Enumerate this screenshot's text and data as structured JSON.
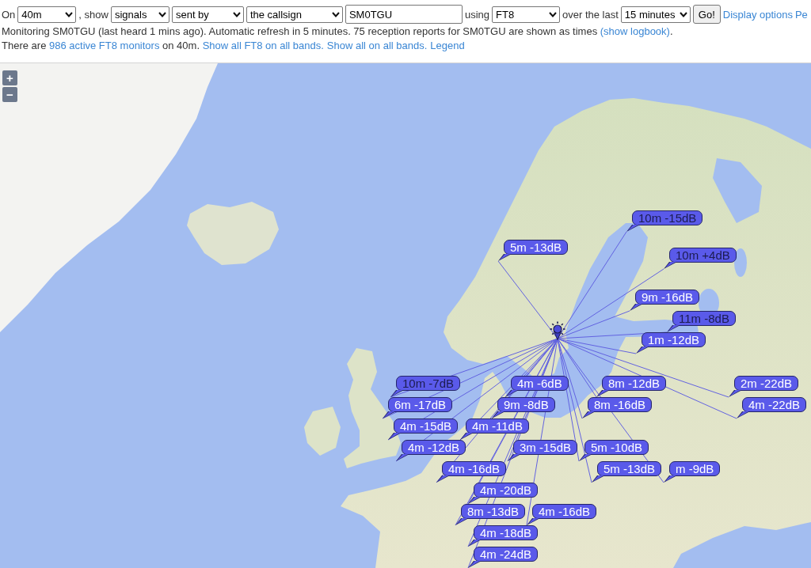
{
  "form": [
    {
      "kind": "text",
      "text": "On"
    },
    {
      "kind": "select",
      "value": "40m"
    },
    {
      "kind": "text",
      "text": ", show"
    },
    {
      "kind": "select",
      "value": "signals"
    },
    {
      "kind": "select",
      "value": "sent by"
    },
    {
      "kind": "select",
      "value": "the callsign"
    },
    {
      "kind": "input",
      "value": "SM0TGU"
    },
    {
      "kind": "text",
      "text": "using"
    },
    {
      "kind": "select",
      "value": "FT8"
    },
    {
      "kind": "text",
      "text": "over the last"
    },
    {
      "kind": "select",
      "value": "15 minutes"
    },
    {
      "kind": "button",
      "text": "Go!"
    },
    {
      "kind": "link",
      "text": "Display options"
    },
    {
      "kind": "link",
      "text": "Pe"
    }
  ],
  "status_lines": [
    [
      {
        "kind": "text",
        "text": "Monitoring SM0TGU (last heard 1 mins ago). Automatic refresh in 5 minutes. 75 reception reports for SM0TGU are shown as times "
      },
      {
        "kind": "link",
        "text": "(show logbook)"
      },
      {
        "kind": "text",
        "text": "."
      }
    ],
    [
      {
        "kind": "text",
        "text": "There are "
      },
      {
        "kind": "link",
        "text": "986 active FT8 monitors"
      },
      {
        "kind": "text",
        "text": " on 40m. "
      },
      {
        "kind": "link",
        "text": "Show all FT8 on all bands."
      },
      {
        "kind": "link",
        "text": "Show all on all bands."
      },
      {
        "kind": "link",
        "text": "Legend"
      }
    ]
  ],
  "map": {
    "zoom_buttons": [
      "+",
      "−"
    ],
    "markers": [
      {
        "label": "10m -15dB",
        "stale": true
      },
      {
        "label": "5m -13dB",
        "stale": false
      },
      {
        "label": "10m +4dB",
        "stale": true
      },
      {
        "label": "9m -16dB",
        "stale": false
      },
      {
        "label": "11m -8dB",
        "stale": true
      },
      {
        "label": "1m -12dB",
        "stale": false
      },
      {
        "label": "10m -7dB",
        "stale": true
      },
      {
        "label": "4m -6dB",
        "stale": false
      },
      {
        "label": "8m -12dB",
        "stale": false
      },
      {
        "label": "2m -22dB",
        "stale": false
      },
      {
        "label": "6m -17dB",
        "stale": false
      },
      {
        "label": "9m -8dB",
        "stale": false
      },
      {
        "label": "8m -16dB",
        "stale": false
      },
      {
        "label": "4m -22dB",
        "stale": false
      },
      {
        "label": "4m -15dB",
        "stale": false
      },
      {
        "label": "4m -11dB",
        "stale": false
      },
      {
        "label": "4m -12dB",
        "stale": false
      },
      {
        "label": "3m -15dB",
        "stale": false
      },
      {
        "label": "5m -10dB",
        "stale": false
      },
      {
        "label": "4m -16dB",
        "stale": false
      },
      {
        "label": "5m -13dB",
        "stale": false
      },
      {
        "label": "m -9dB",
        "stale": false
      },
      {
        "label": "4m -20dB",
        "stale": false
      },
      {
        "label": "8m -13dB",
        "stale": false
      },
      {
        "label": "4m -16dB",
        "stale": false
      },
      {
        "label": "4m -18dB",
        "stale": false
      },
      {
        "label": "4m -24dB",
        "stale": false
      }
    ]
  }
}
